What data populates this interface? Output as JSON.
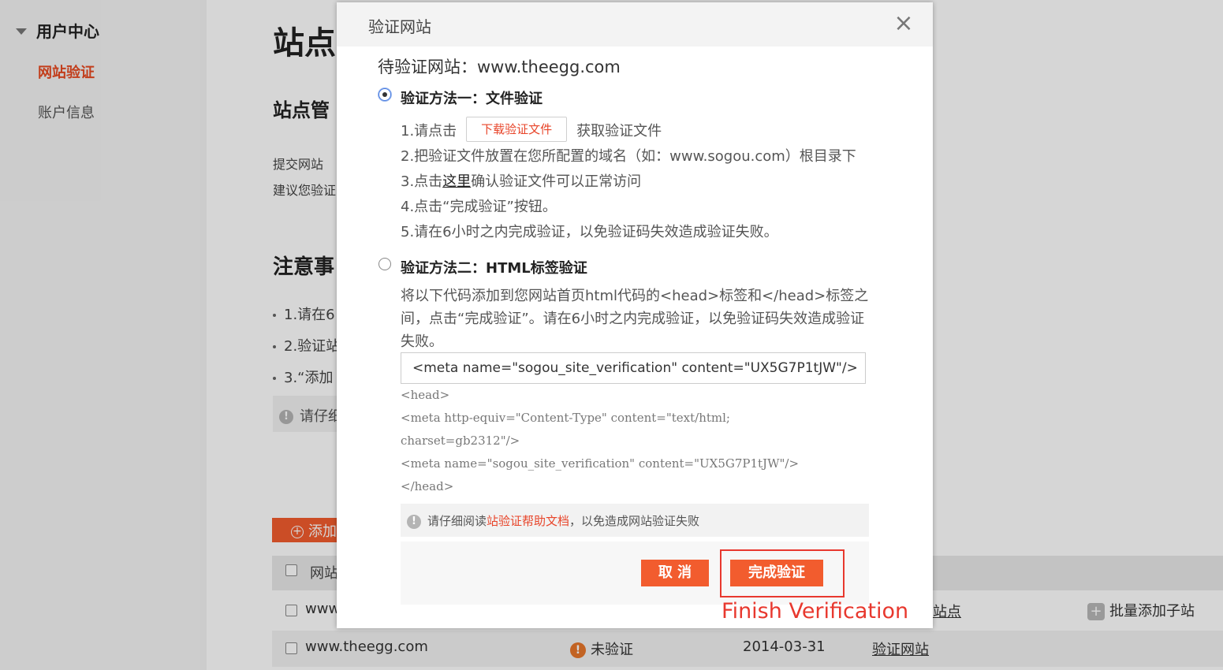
{
  "sidebar": {
    "group_title": "用户中心",
    "items": [
      {
        "label": "网站验证",
        "active": true
      },
      {
        "label": "账户信息",
        "active": false
      }
    ]
  },
  "main": {
    "title": "站点",
    "subtitle": "站点管",
    "desc_lines": [
      "提交网站",
      "建议您验证"
    ],
    "notice_title": "注意事",
    "notice_items": [
      "1.请在6",
      "2.验证站",
      "3.“添加"
    ],
    "tip_text": "请仔细",
    "add_button": "添加",
    "table": {
      "header": "网站",
      "row1": {
        "site": "www.",
        "action": "站点",
        "batch": "批量添加子站"
      },
      "row2": {
        "site": "www.theegg.com",
        "status": "未验证",
        "date": "2014-03-31",
        "action": "验证网站"
      }
    }
  },
  "modal": {
    "title": "验证网站",
    "close_glyph": "×",
    "pending_label": "待验证网站：www.theegg.com",
    "method1": {
      "title": "验证方法一：文件验证",
      "step1_prefix": "1.请点击",
      "download_button": "下载验证文件",
      "step1_suffix": "获取验证文件",
      "step2": "2.把验证文件放置在您所配置的域名（如：www.sogou.com）根目录下",
      "step3_prefix": "3.点击",
      "step3_link": "这里",
      "step3_suffix": "确认验证文件可以正常访问",
      "step4": "4.点击“完成验证”按钮。",
      "step5": "5.请在6小时之内完成验证，以免验证码失效造成验证失败。"
    },
    "method2": {
      "title": "验证方法二：HTML标签验证",
      "description": "将以下代码添加到您网站首页html代码的<head>标签和</head>标签之间，点击“完成验证”。请在6小时之内完成验证，以免验证码失效造成验证失败。",
      "meta_code": "<meta name=\"sogou_site_verification\" content=\"UX5G7P1tJW\"/>",
      "example_lines": [
        "<head>",
        "<meta http-equiv=\"Content-Type\" content=\"text/html;",
        "charset=gb2312\"/>",
        "<meta name=\"sogou_site_verification\" content=\"UX5G7P1tJW\"/>",
        "</head>"
      ]
    },
    "help": {
      "prefix": "请仔细阅读",
      "link": "站验证帮助文档",
      "suffix": "，以免造成网站验证失败"
    },
    "cancel_button": "取 消",
    "finish_button": "完成验证"
  },
  "annotation": {
    "label": "Finish Verification",
    "color": "#e8382e"
  },
  "colors": {
    "accent": "#f25c2e",
    "active_nav": "#e84a22"
  }
}
